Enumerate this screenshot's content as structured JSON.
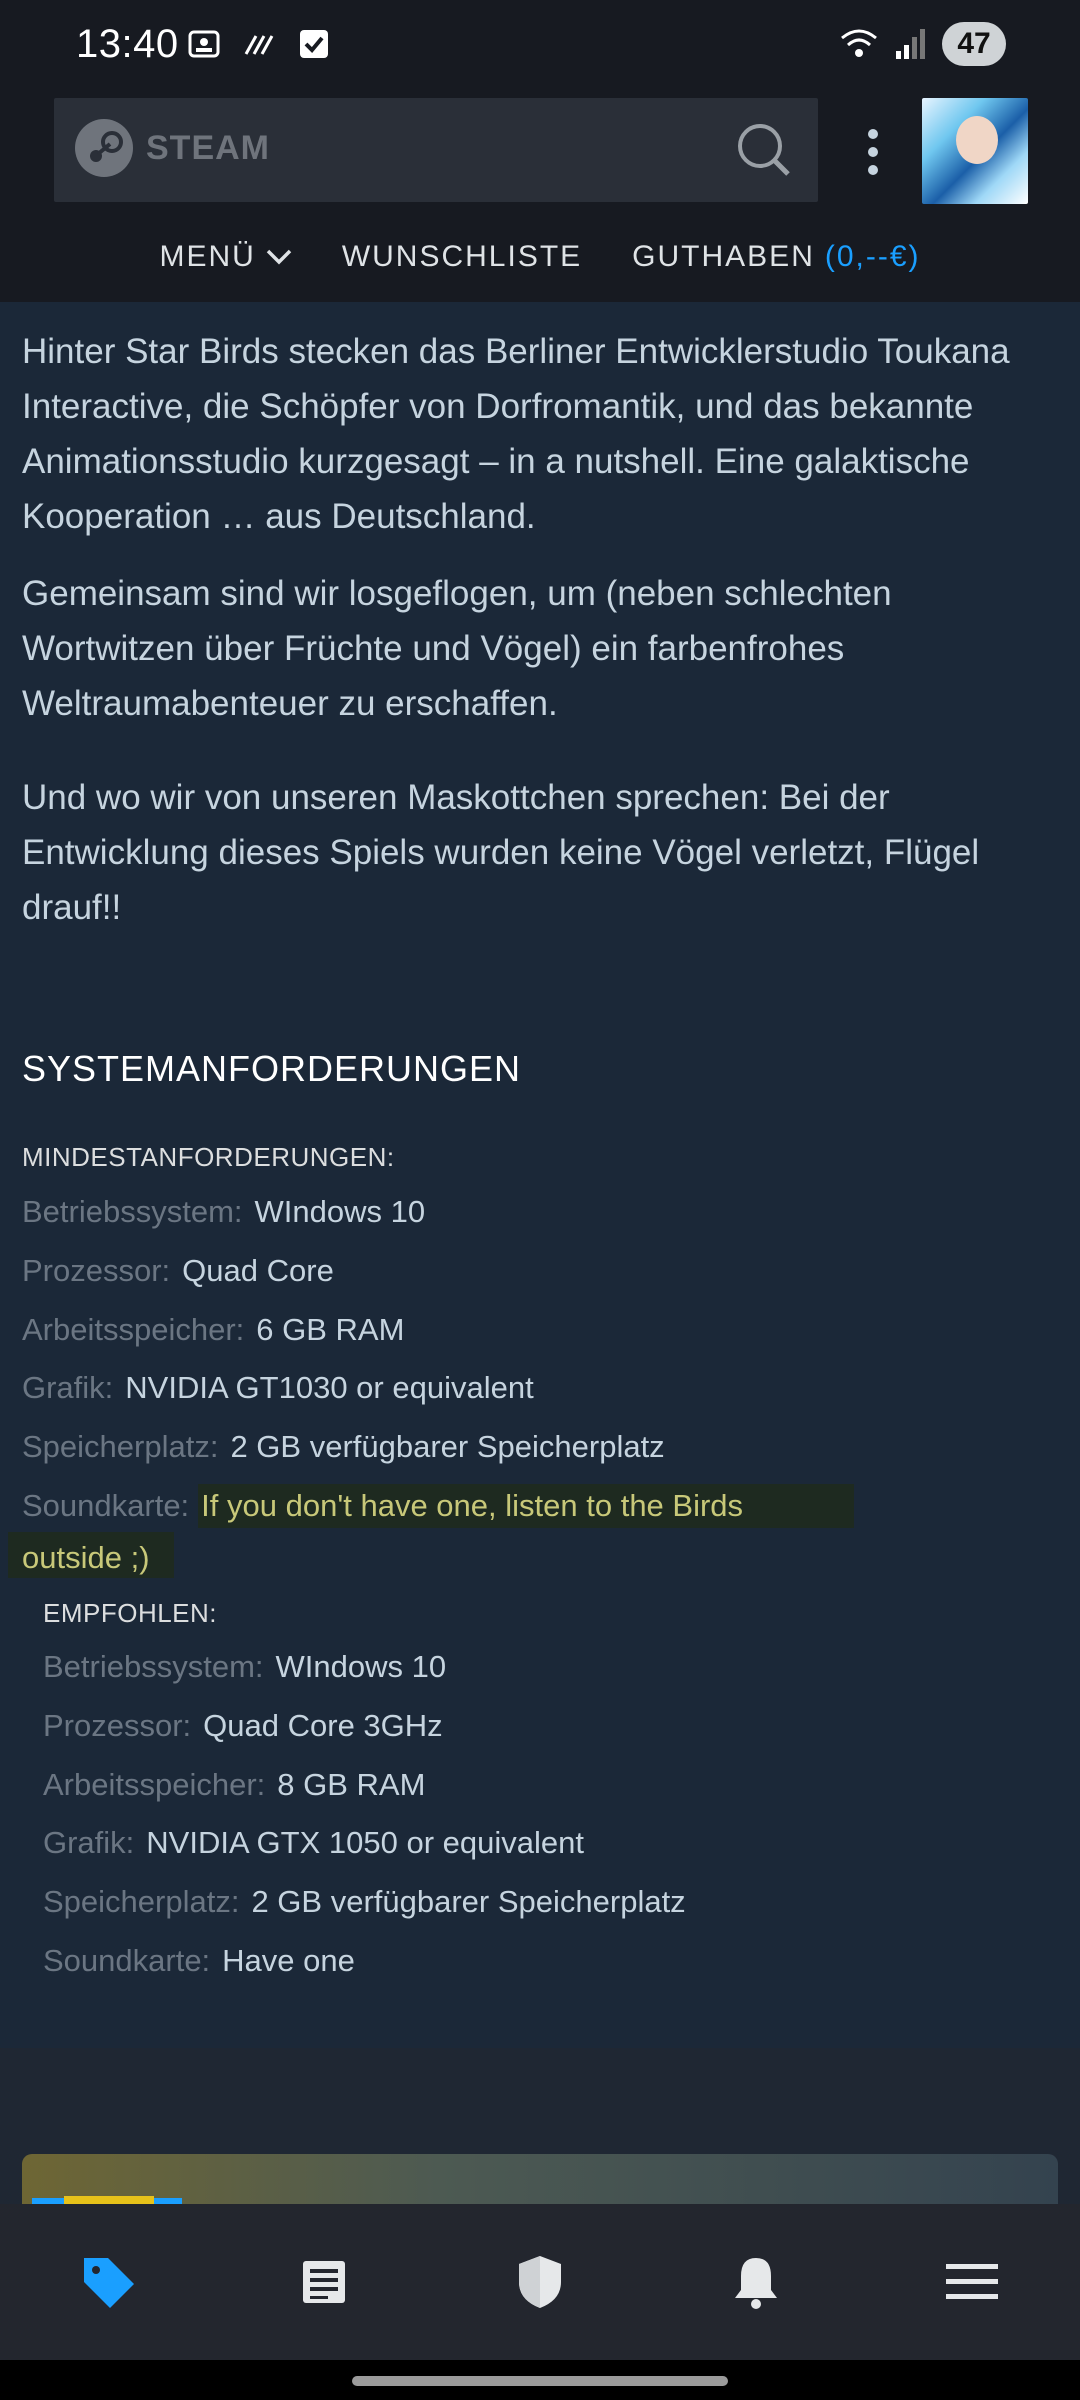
{
  "status": {
    "time": "13:40",
    "battery": "47"
  },
  "header": {
    "brand": "STEAM",
    "nav": {
      "menu": "MENÜ",
      "wishlist": "WUNSCHLISTE",
      "wallet_label": "GUTHABEN",
      "wallet_amount": "(0,--€)"
    }
  },
  "description": {
    "p1": "Hinter Star Birds stecken das Berliner Entwicklerstudio Toukana Interactive, die Schöpfer von Dorfromantik, und das bekannte Animationsstudio kurzgesagt – in a nutshell. Eine galaktische Kooperation … aus Deutschland.",
    "p2": "Gemeinsam sind wir losgeflogen, um (neben schlechten Wortwitzen über Früchte und Vögel) ein farbenfrohes Weltraumabenteuer zu erschaffen.",
    "p3": "Und wo wir von unseren Maskottchen sprechen: Bei der Entwicklung dieses Spiels wurden keine Vögel verletzt, Flügel drauf!!"
  },
  "sysreq": {
    "title": "SYSTEMANFORDERUNGEN",
    "minimum": {
      "heading": "MINDESTANFORDERUNGEN:",
      "rows": [
        {
          "key": "Betriebssystem:",
          "value": "WIndows 10"
        },
        {
          "key": "Prozessor:",
          "value": "Quad Core"
        },
        {
          "key": "Arbeitsspeicher:",
          "value": "6 GB RAM"
        },
        {
          "key": "Grafik:",
          "value": "NVIDIA GT1030 or equivalent"
        },
        {
          "key": "Speicherplatz:",
          "value": "2 GB verfügbarer Speicherplatz"
        }
      ],
      "sound_key": "Soundkarte:",
      "sound_value_line1": "If you don't have one, listen to the Birds",
      "sound_value_line2": "outside ;)"
    },
    "recommended": {
      "heading": "EMPFOHLEN:",
      "rows": [
        {
          "key": "Betriebssystem:",
          "value": "WIndows 10"
        },
        {
          "key": "Prozessor:",
          "value": "Quad Core 3GHz"
        },
        {
          "key": "Arbeitsspeicher:",
          "value": "8 GB RAM"
        },
        {
          "key": "Grafik:",
          "value": "NVIDIA GTX 1050 or equivalent"
        },
        {
          "key": "Speicherplatz:",
          "value": "2 GB verfügbarer Speicherplatz"
        },
        {
          "key": "Soundkarte:",
          "value": "Have one"
        }
      ]
    }
  },
  "colors": {
    "accent": "#1a9fff",
    "background": "#1b2838",
    "header": "#171a21",
    "highlight_text": "#c8c879"
  },
  "bottom_nav": {
    "items": [
      "store-tag-icon",
      "news-icon",
      "shield-icon",
      "bell-icon",
      "menu-icon"
    ],
    "active": "store-tag-icon"
  }
}
